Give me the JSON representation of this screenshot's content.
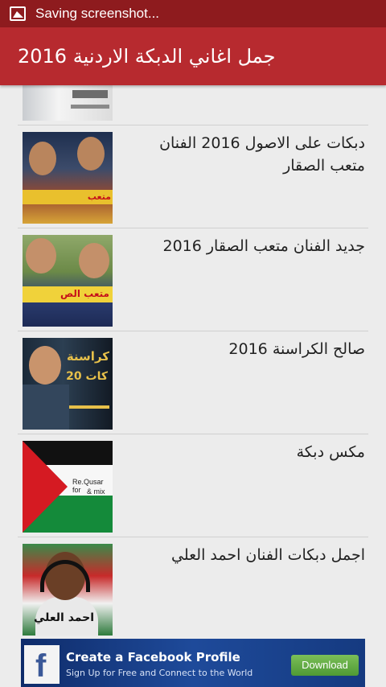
{
  "status_bar": {
    "notification_icon": "screenshot-icon",
    "text": "Saving screenshot..."
  },
  "app_bar": {
    "title": "جمل اغاني الدبكة الاردنية 2016"
  },
  "list": {
    "items": [
      {
        "title": "",
        "thumb": "thumbnail-partial"
      },
      {
        "title": "دبكات على الاصول 2016 الفنان متعب الصقار",
        "thumb": "thumbnail-singers-mic"
      },
      {
        "title": "جديد الفنان متعب الصقار 2016",
        "thumb": "thumbnail-singer-mic"
      },
      {
        "title": "صالح الكراسنة 2016",
        "thumb": "thumbnail-singer-poster"
      },
      {
        "title": "مكس دبكة",
        "thumb": "thumbnail-palestine-flag",
        "thumb_text": [
          "Re.Qusar for",
          "& mix"
        ]
      },
      {
        "title": "اجمل دبكات الفنان احمد العلي",
        "thumb": "thumbnail-singer-headset"
      }
    ]
  },
  "ad_banner": {
    "title": "Create a Facebook Profile",
    "subtitle": "Sign Up for Free and Connect to the World",
    "button_label": "Download",
    "logo_icon": "facebook-logo-icon",
    "colors": {
      "background": "#1e4a9a",
      "button": "#5fa93f",
      "logo": "#3b5998"
    }
  },
  "colors": {
    "status_bar": "#8e1b1e",
    "app_bar": "#b72a2f",
    "background": "#ececec"
  }
}
